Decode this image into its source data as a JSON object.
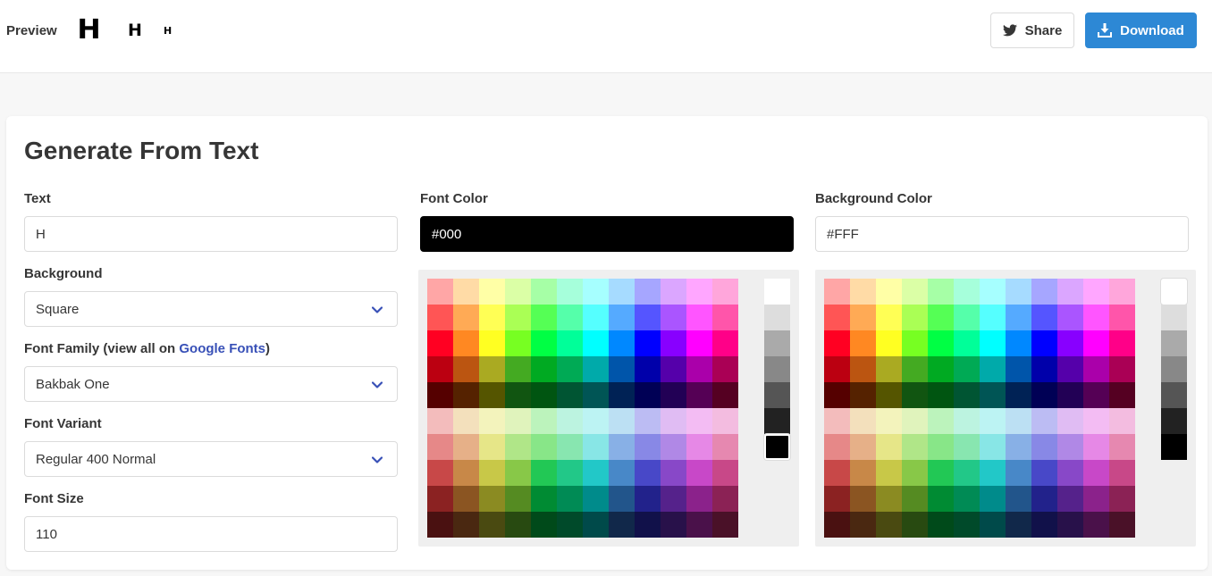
{
  "header": {
    "preview_label": "Preview",
    "preview_glyph": "H",
    "share_label": "Share",
    "download_label": "Download"
  },
  "form": {
    "title": "Generate From Text",
    "text": {
      "label": "Text",
      "value": "H"
    },
    "background": {
      "label": "Background",
      "value": "Square"
    },
    "font_family": {
      "label_prefix": "Font Family (view all on ",
      "link_text": "Google Fonts",
      "label_suffix": ")",
      "value": "Bakbak One"
    },
    "font_variant": {
      "label": "Font Variant",
      "value": "Regular 400 Normal"
    },
    "font_size": {
      "label": "Font Size",
      "value": "110"
    },
    "font_color": {
      "label": "Font Color",
      "value": "#000"
    },
    "background_color": {
      "label": "Background Color",
      "value": "#FFF"
    }
  },
  "colors": {
    "accent": "#2d88d5",
    "link": "#3850b7"
  },
  "palette": {
    "rows": [
      [
        "#ffa6a6",
        "#ffdba6",
        "#ffffa6",
        "#dbffa6",
        "#a6ffa6",
        "#a6ffdb",
        "#a6ffff",
        "#a6dbff",
        "#a6a6ff",
        "#dba6ff",
        "#ffa6ff",
        "#ffa6db"
      ],
      [
        "#ff5555",
        "#ffaa55",
        "#ffff55",
        "#aaff55",
        "#55ff55",
        "#55ffaa",
        "#55ffff",
        "#55aaff",
        "#5555ff",
        "#aa55ff",
        "#ff55ff",
        "#ff55aa"
      ],
      [
        "#ff0022",
        "#ff8822",
        "#ffff22",
        "#77ff22",
        "#00ff44",
        "#00ff99",
        "#00ffff",
        "#0088ff",
        "#0000ff",
        "#8800ff",
        "#ff00ff",
        "#ff0088"
      ],
      [
        "#bb0011",
        "#bb5511",
        "#aaaa22",
        "#44aa22",
        "#00aa22",
        "#00aa55",
        "#00aaaa",
        "#0055aa",
        "#0000aa",
        "#5500aa",
        "#aa00aa",
        "#aa0055"
      ],
      [
        "#550000",
        "#552200",
        "#555500",
        "#115511",
        "#005511",
        "#005533",
        "#005555",
        "#002255",
        "#000055",
        "#220055",
        "#550055",
        "#550022"
      ],
      [
        "#f3bcbc",
        "#f3e0bc",
        "#f3f3bc",
        "#e0f3bc",
        "#bcf3bc",
        "#bcf3e0",
        "#bcf3f3",
        "#bce0f3",
        "#bcbcf3",
        "#e0bcf3",
        "#f3bcf3",
        "#f3bce0"
      ],
      [
        "#e68888",
        "#e6b088",
        "#e6e688",
        "#b0e688",
        "#88e688",
        "#88e6b0",
        "#88e6e6",
        "#88b0e6",
        "#8888e6",
        "#b088e6",
        "#e688e6",
        "#e688b0"
      ],
      [
        "#c84848",
        "#c88848",
        "#c8c848",
        "#88c848",
        "#22c855",
        "#22c888",
        "#22c8c8",
        "#4888c8",
        "#4848c8",
        "#8848c8",
        "#c848c8",
        "#c84888"
      ],
      [
        "#8b2222",
        "#8b5522",
        "#8b8b22",
        "#558b22",
        "#008b33",
        "#008b55",
        "#008b8b",
        "#22558b",
        "#22228b",
        "#55228b",
        "#8b228b",
        "#8b2255"
      ],
      [
        "#4a1111",
        "#4a2811",
        "#4a4a11",
        "#284a11",
        "#004a1a",
        "#004a2a",
        "#004a4a",
        "#11284a",
        "#11114a",
        "#28114a",
        "#4a114a",
        "#4a1128"
      ]
    ],
    "grays": [
      "#ffffff",
      "#dddddd",
      "#aaaaaa",
      "#888888",
      "#555555",
      "#222222",
      "#000000"
    ]
  }
}
